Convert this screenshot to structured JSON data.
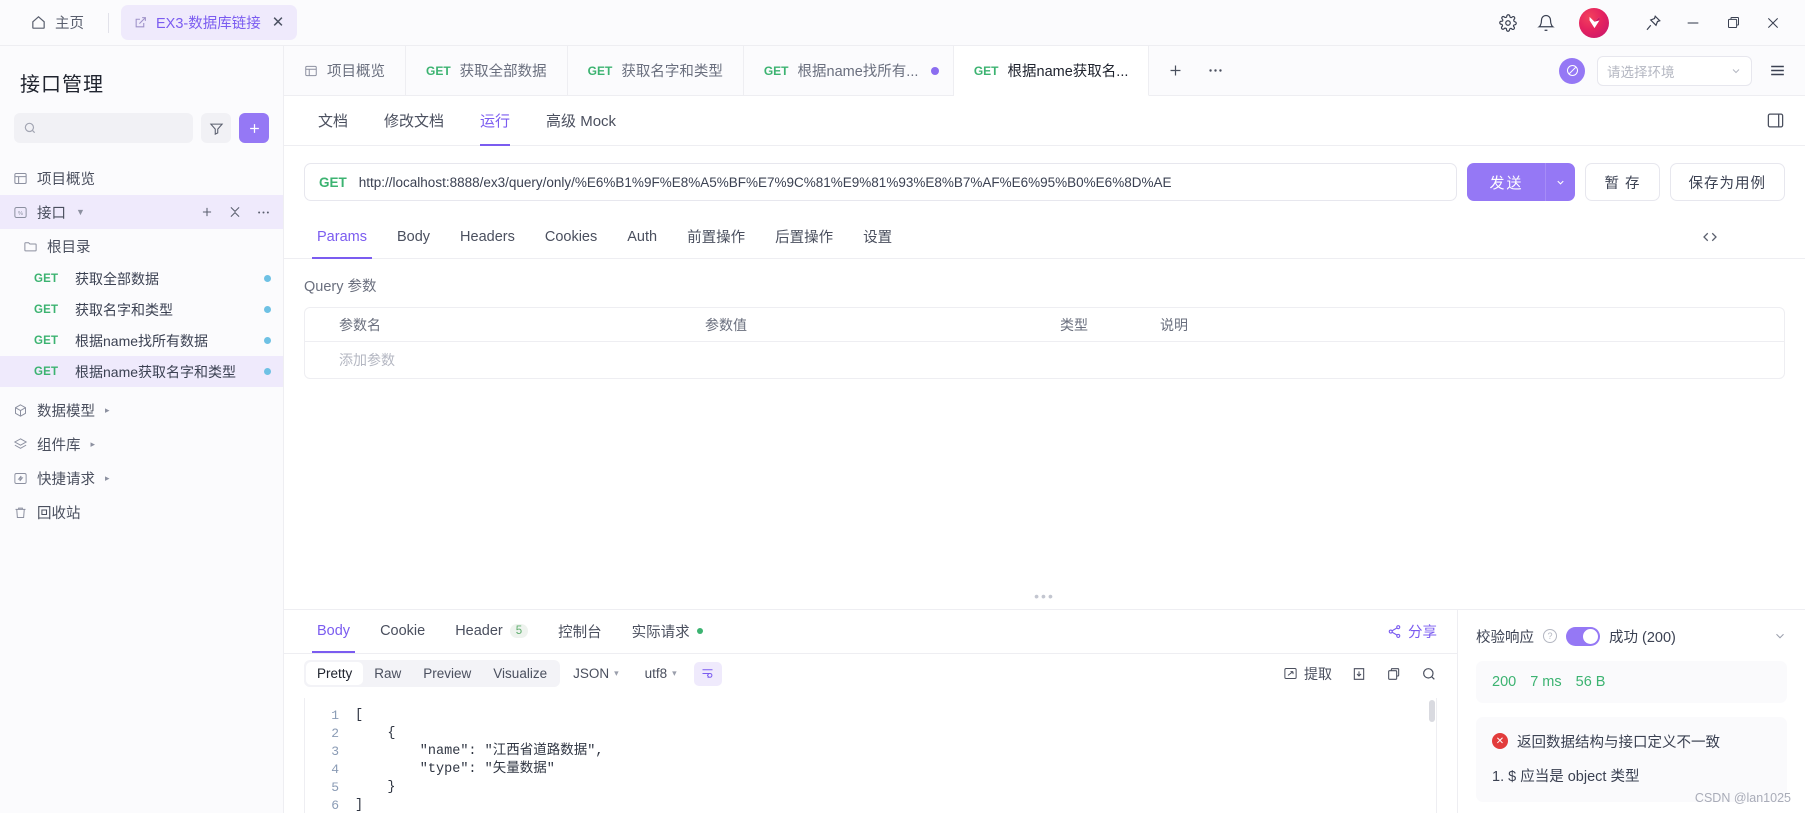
{
  "titlebar": {
    "home_label": "主页",
    "doc_tab_label": "EX3-数据库链接",
    "icons": [
      "gear-icon",
      "bell-icon",
      "app-logo",
      "pin-icon",
      "minimize-icon",
      "maximize-icon",
      "close-icon"
    ]
  },
  "sidebar": {
    "title": "接口管理",
    "search_placeholder": "",
    "filter_label": "filter-icon",
    "add_label": "+",
    "overview_label": "项目概览",
    "api_group_label": "接口",
    "folder_label": "根目录",
    "apis": [
      {
        "verb": "GET",
        "name": "获取全部数据",
        "active": false
      },
      {
        "verb": "GET",
        "name": "获取名字和类型",
        "active": false
      },
      {
        "verb": "GET",
        "name": "根据name找所有数据",
        "active": false
      },
      {
        "verb": "GET",
        "name": "根据name获取名字和类型",
        "active": true
      }
    ],
    "sections": [
      {
        "label": "数据模型",
        "icon": "box-icon"
      },
      {
        "label": "组件库",
        "icon": "layers-icon"
      },
      {
        "label": "快捷请求",
        "icon": "bolt-icon"
      },
      {
        "label": "回收站",
        "icon": "trash-icon"
      }
    ]
  },
  "tabstrip": {
    "tabs": [
      {
        "verb": "",
        "label": "项目概览",
        "active": false,
        "dot": false,
        "icon": "layout-icon"
      },
      {
        "verb": "GET",
        "label": "获取全部数据",
        "active": false,
        "dot": false
      },
      {
        "verb": "GET",
        "label": "获取名字和类型",
        "active": false,
        "dot": false
      },
      {
        "verb": "GET",
        "label": "根据name找所有...",
        "active": false,
        "dot": true
      },
      {
        "verb": "GET",
        "label": "根据name获取名...",
        "active": true,
        "dot": false
      }
    ],
    "add_label": "+",
    "more_label": "···",
    "env_placeholder": "请选择环境"
  },
  "subtabs": [
    {
      "label": "文档",
      "active": false
    },
    {
      "label": "修改文档",
      "active": false
    },
    {
      "label": "运行",
      "active": true
    },
    {
      "label": "高级 Mock",
      "active": false
    }
  ],
  "request": {
    "method": "GET",
    "url": "http://localhost:8888/ex3/query/only/%E6%B1%9F%E8%A5%BF%E7%9C%81%E9%81%93%E8%B7%AF%E6%95%B0%E6%8D%AE",
    "send_label": "发送",
    "save_draft_label": "暂 存",
    "save_case_label": "保存为用例"
  },
  "param_tabs": [
    {
      "label": "Params",
      "active": true
    },
    {
      "label": "Body",
      "active": false
    },
    {
      "label": "Headers",
      "active": false
    },
    {
      "label": "Cookies",
      "active": false
    },
    {
      "label": "Auth",
      "active": false
    },
    {
      "label": "前置操作",
      "active": false
    },
    {
      "label": "后置操作",
      "active": false
    },
    {
      "label": "设置",
      "active": false
    }
  ],
  "query": {
    "section_label": "Query 参数",
    "columns": [
      "参数名",
      "参数值",
      "类型",
      "说明"
    ],
    "empty_row_placeholder": "添加参数"
  },
  "response": {
    "tabs": [
      {
        "label": "Body",
        "active": true,
        "badge": "",
        "dot": false
      },
      {
        "label": "Cookie",
        "active": false,
        "badge": "",
        "dot": false
      },
      {
        "label": "Header",
        "active": false,
        "badge": "5",
        "dot": false
      },
      {
        "label": "控制台",
        "active": false,
        "badge": "",
        "dot": false
      },
      {
        "label": "实际请求",
        "active": false,
        "badge": "",
        "dot": true
      }
    ],
    "share_label": "分享",
    "format_modes": [
      {
        "label": "Pretty",
        "active": true
      },
      {
        "label": "Raw",
        "active": false
      },
      {
        "label": "Preview",
        "active": false
      },
      {
        "label": "Visualize",
        "active": false
      }
    ],
    "content_type": "JSON",
    "charset": "utf8",
    "extract_label": "提取",
    "toolbar_icons": [
      "wrap-icon",
      "extract-icon",
      "download-icon",
      "copy-icon",
      "search-icon"
    ],
    "line_numbers": [
      "1",
      "2",
      "3",
      "4",
      "5",
      "6"
    ],
    "body_json": "[\n    {\n        \"name\": \"江西省道路数据\",\n        \"type\": \"矢量数据\"\n    }\n]"
  },
  "validation": {
    "label": "校验响应",
    "status_label": "成功 (200)",
    "status_code": "200",
    "time": "7 ms",
    "size": "56 B",
    "error_title": "返回数据结构与接口定义不一致",
    "error_items": [
      "1. $ 应当是 object 类型"
    ]
  },
  "watermark": "CSDN @lan1025",
  "colors": {
    "accent": "#7b5cf0",
    "accent_button": "#9578f5",
    "verb_get": "#3cb371",
    "error": "#e23c3c",
    "tab_active_bg": "#efeafc"
  }
}
